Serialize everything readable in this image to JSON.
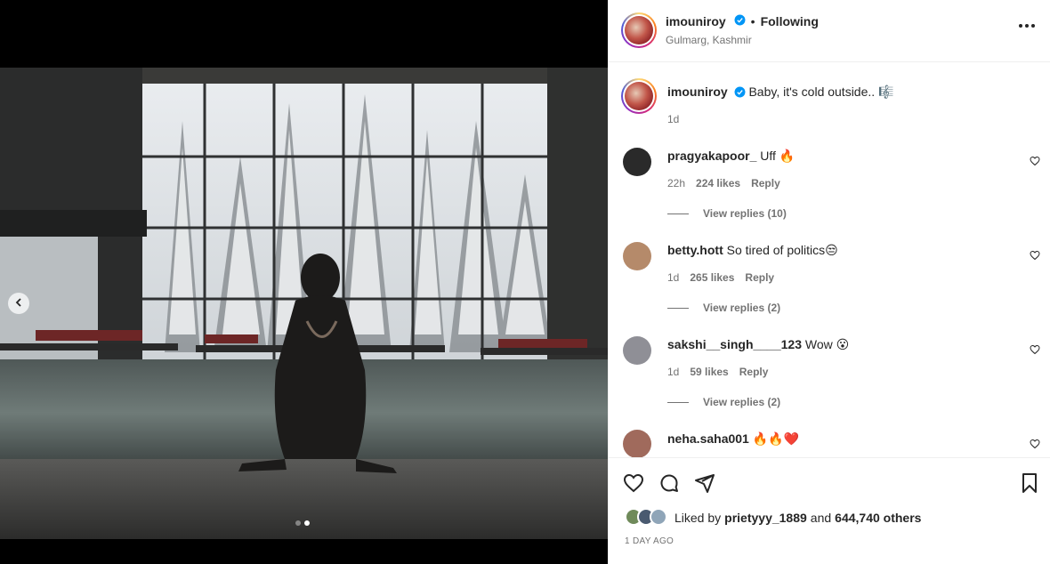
{
  "post": {
    "author": "imouniroy",
    "follow_status": "Following",
    "separator": "•",
    "location": "Gulmarg, Kashmir",
    "carousel": {
      "total": 2,
      "active": 2
    }
  },
  "caption": {
    "username": "imouniroy",
    "text": "Baby, it's cold outside.. 🎼",
    "time": "1d"
  },
  "comments": [
    {
      "username": "pragyakapoor_",
      "text": "Uff 🔥",
      "time": "22h",
      "likes": "224 likes",
      "reply": "Reply",
      "view_replies": "View replies (10)",
      "avatar_color": "#2a2a2a"
    },
    {
      "username": "betty.hott",
      "text": "So tired of politics😒",
      "time": "1d",
      "likes": "265 likes",
      "reply": "Reply",
      "view_replies": "View replies (2)",
      "avatar_color": "#b58a6a"
    },
    {
      "username": "sakshi__singh____123",
      "text": "Wow 😮",
      "time": "1d",
      "likes": "59 likes",
      "reply": "Reply",
      "view_replies": "View replies (2)",
      "avatar_color": "#8f8f96"
    },
    {
      "username": "neha.saha001",
      "text": "🔥🔥❤️",
      "avatar_color": "#a06a5c"
    }
  ],
  "likes": {
    "prefix": "Liked by",
    "user": "prietyyy_1889",
    "middle": "and",
    "others": "644,740 others"
  },
  "time_ago": "1 DAY AGO",
  "icons": {
    "like": "heart-icon",
    "comment": "comment-icon",
    "share": "share-icon",
    "save": "bookmark-icon",
    "more": "more-icon",
    "verified": "verified-badge-icon",
    "prev": "chevron-left-icon"
  },
  "colors": {
    "verified": "#0095f6",
    "text": "#262626",
    "muted": "#737373"
  }
}
